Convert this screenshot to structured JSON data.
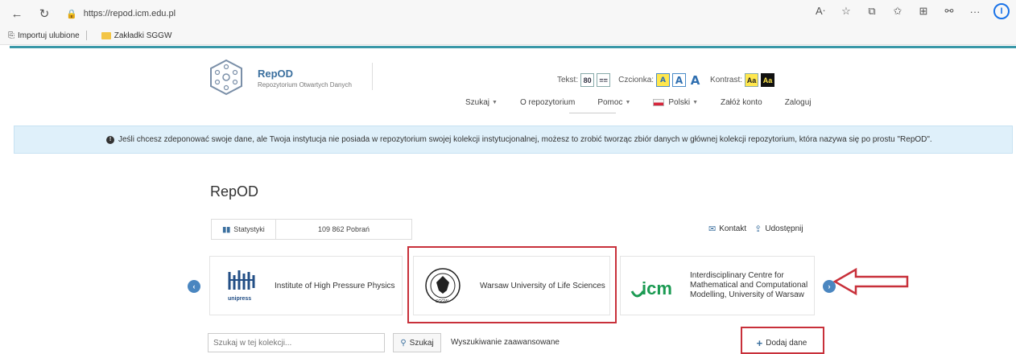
{
  "browser": {
    "url": "https://repod.icm.edu.pl",
    "bookmarks": [
      "Importuj ulubione",
      "Zakładki SGGW"
    ]
  },
  "header": {
    "brand_name": "RepOD",
    "brand_sub": "Repozytorium Otwartych Danych",
    "text_label": "Tekst:",
    "text_size_value": "80",
    "text_width_value": "==",
    "font_label": "Czcionka:",
    "font_a": "A",
    "contrast_label": "Kontrast:",
    "contrast_value": "Aa"
  },
  "menu": {
    "search": "Szukaj",
    "about": "O repozytorium",
    "help": "Pomoc",
    "language": "Polski",
    "register": "Załóż konto",
    "login": "Zaloguj"
  },
  "alert": {
    "text": "Jeśli chcesz zdeponować swoje dane, ale Twoja instytucja nie posiada w repozytorium swojej kolekcji instytucjonalnej, możesz to zrobić tworząc zbiór danych w głównej kolekcji repozytorium, która nazywa się po prostu \"RepOD\"."
  },
  "main": {
    "title": "RepOD",
    "stats_label": "Statystyki",
    "downloads": "109 862 Pobrań",
    "contact": "Kontakt",
    "share": "Udostępnij",
    "cards": [
      {
        "logo_text": "unipress",
        "name": "Institute of High Pressure Physics"
      },
      {
        "logo_text": "SGGW",
        "name": "Warsaw University of Life Sciences"
      },
      {
        "logo_text": "icm",
        "name": "Interdisciplinary Centre for Mathematical and Computational Modelling, University of Warsaw"
      }
    ],
    "search_placeholder": "Szukaj w tej kolekcji...",
    "search_button": "Szukaj",
    "advanced_search": "Wyszukiwanie zaawansowane",
    "add_data": "Dodaj dane"
  },
  "colors": {
    "accent": "#3a6f9e",
    "highlight": "#c8303a",
    "alert_bg": "#dff0fa"
  }
}
